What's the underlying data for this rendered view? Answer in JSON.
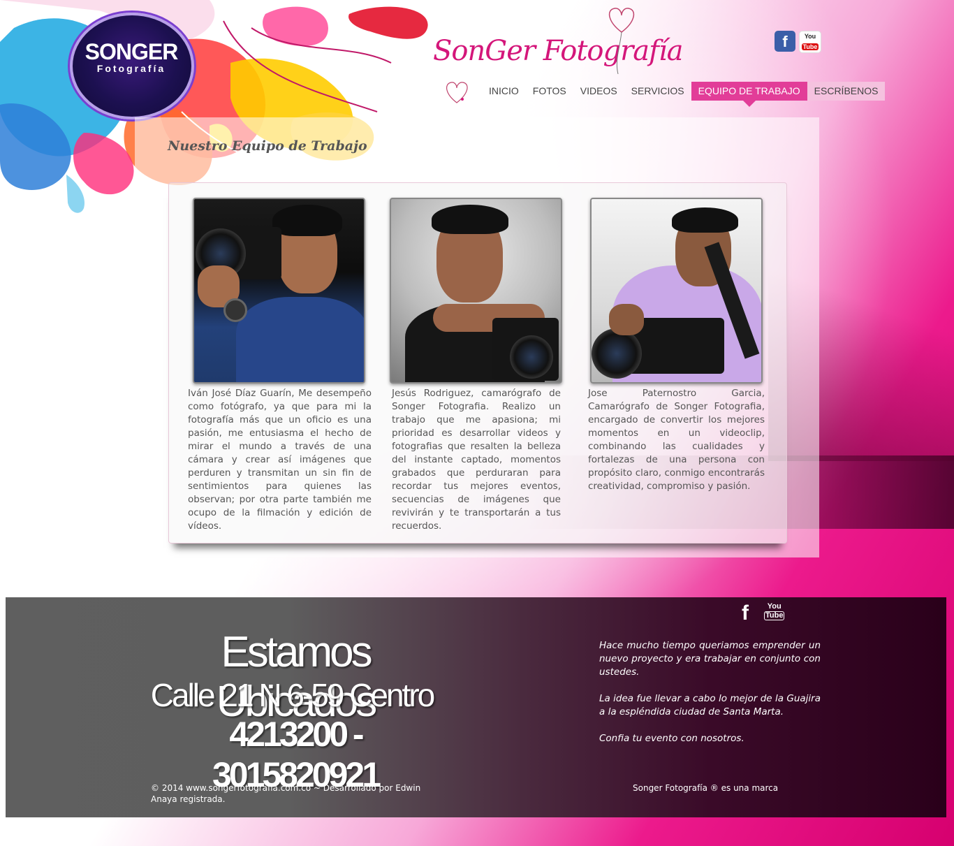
{
  "header": {
    "logo_main": "SONGER",
    "logo_sub": "Fotografía",
    "brand": "SonGer Fotografía",
    "social": {
      "facebook_glyph": "f",
      "youtube_you": "You",
      "youtube_tube": "Tube"
    }
  },
  "nav": {
    "items": [
      {
        "label": "INICIO"
      },
      {
        "label": "FOTOS"
      },
      {
        "label": "VIDEOS"
      },
      {
        "label": "SERVICIOS"
      },
      {
        "label": "EQUIPO DE TRABAJO"
      },
      {
        "label": "ESCRÍBENOS"
      }
    ],
    "active": "EQUIPO DE TRABAJO"
  },
  "main": {
    "title": "Nuestro Equipo de Trabajo",
    "team": [
      {
        "description": "Iván José Díaz Guarín, Me desempeño como fotógrafo, ya que para mi la fotografía más que un oficio es una pasión, me entusiasma el hecho de mirar el mundo a través de una cámara y crear así imágenes que perduren y transmitan un sin fin de sentimientos para quienes las observan; por otra parte también me ocupo de la filmación y edición de vídeos."
      },
      {
        "description": "Jesús Rodriguez, camarógrafo de Songer Fotografia. Realizo un trabajo que me apasiona; mi prioridad es desarrollar videos y fotografias que resalten la belleza del instante captado, momentos grabados que perduraran para recordar tus mejores eventos, secuencias de imágenes que revivirán y te transportarán a tus recuerdos."
      },
      {
        "description": "Jose Paternostro Garcia, Camarógrafo de Songer Fotografia, encargado de convertir los mejores momentos en un videoclip, combinando las cualidades y fortalezas de una persona con propósito claro, conmigo encontrarás creatividad, compromiso y pasión."
      }
    ]
  },
  "footer": {
    "location_title": "Estamos Ubicados",
    "address": "Calle 21 N 6-59 Centro",
    "phones": "4213200 - 3015820921",
    "about": [
      "Hace mucho tiempo queriamos emprender un nuevo proyecto y era trabajar en conjunto con ustedes.",
      "La idea fue llevar a cabo lo mejor de la Guajira  a la espléndida ciudad de Santa Marta.",
      "Confia tu evento con nosotros."
    ],
    "copyright": "© 2014 www.songerfotografia.com.co ~ Desarrollado por Edwin Anaya registrada.",
    "trademark": "Songer Fotografía ® es una marca",
    "social": {
      "facebook_glyph": "f",
      "youtube_you": "You",
      "youtube_tube": "Tube"
    }
  },
  "colors": {
    "accent": "#e23d98",
    "brand": "#d4167a",
    "facebook": "#3b5ea8",
    "footer_gray": "#5e5e5e",
    "footer_dark": "#2a001a"
  },
  "icons": [
    "facebook-icon",
    "youtube-icon",
    "heart-balloon-icon"
  ]
}
